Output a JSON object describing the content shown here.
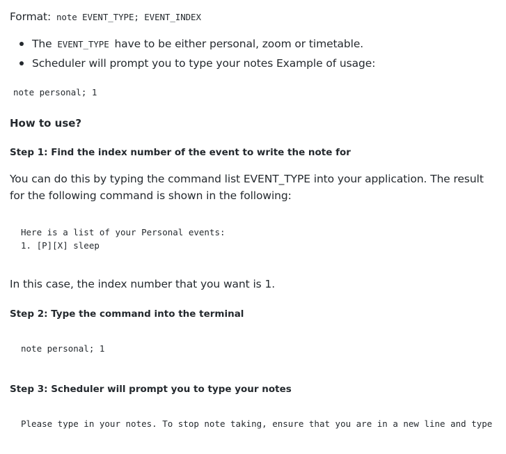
{
  "format": {
    "prefix": "Format:",
    "code": "note EVENT_TYPE; EVENT_INDEX"
  },
  "bullets": [
    {
      "pre": "The",
      "code": "EVENT_TYPE",
      "post": "have to be either personal, zoom or timetable."
    },
    {
      "text": "Scheduler will prompt you to type your notes Example of usage:"
    }
  ],
  "example_code": "note personal; 1",
  "how_to_heading": "How to use?",
  "step1": {
    "heading": "Step 1: Find the index number of the event to write the note for",
    "paragraph": "You can do this by typing the command list EVENT_TYPE into your application. The result for the following command is shown in the following:",
    "output_lines": [
      "Here is a list of your Personal events:",
      "1. [P][X] sleep"
    ],
    "conclusion": "In this case, the index number that you want is 1."
  },
  "step2": {
    "heading": "Step 2: Type the command into the terminal",
    "code": "note personal; 1"
  },
  "step3": {
    "heading": "Step 3: Scheduler will prompt you to type your notes",
    "code": "Please type in your notes. To stop note taking, ensure that you are in a new line and type"
  }
}
